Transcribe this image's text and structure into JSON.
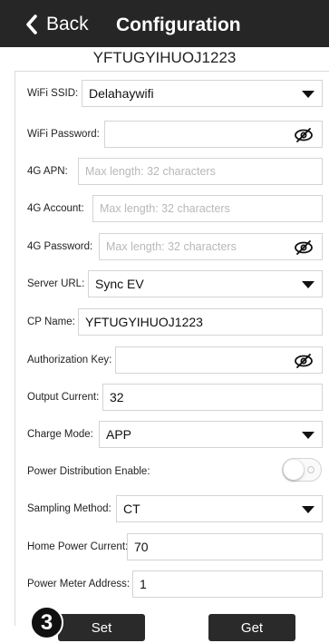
{
  "header": {
    "back_label": "Back",
    "title": "Configuration"
  },
  "device_id": "YFTUGYIHUOJ1223",
  "fields": {
    "wifi_ssid": {
      "label": "WiFi SSID:",
      "value": "Delahaywifi"
    },
    "wifi_password": {
      "label": "WiFi Password:",
      "value": ""
    },
    "apn_4g": {
      "label": "4G APN:",
      "placeholder": "Max length: 32 characters"
    },
    "account_4g": {
      "label": "4G Account:",
      "placeholder": "Max length: 32 characters"
    },
    "password_4g": {
      "label": "4G Password:",
      "placeholder": "Max length: 32 characters"
    },
    "server_url": {
      "label": "Server URL:",
      "value": "Sync EV"
    },
    "cp_name": {
      "label": "CP Name:",
      "value": "YFTUGYIHUOJ1223"
    },
    "authorization_key": {
      "label": "Authorization Key:",
      "value": ""
    },
    "output_current": {
      "label": "Output Current:",
      "value": "32"
    },
    "charge_mode": {
      "label": "Charge Mode:",
      "value": "APP"
    },
    "power_distribution": {
      "label": "Power Distribution Enable:",
      "enabled": false
    },
    "sampling_method": {
      "label": "Sampling Method:",
      "value": "CT"
    },
    "home_power_current": {
      "label": "Home Power Current:",
      "value": "70"
    },
    "power_meter_address": {
      "label": "Power Meter Address:",
      "value": "1"
    }
  },
  "buttons": {
    "set_label": "Set",
    "get_label": "Get"
  },
  "step_badge": "3",
  "icons": {
    "back": "chevron-left-icon",
    "dropdown": "caret-down-icon",
    "password": "eye-slash-icon"
  },
  "colors": {
    "header_bg": "#262626",
    "button_bg": "#2a2a2a",
    "border": "#d4d4d4",
    "placeholder": "#b8b8b8"
  }
}
